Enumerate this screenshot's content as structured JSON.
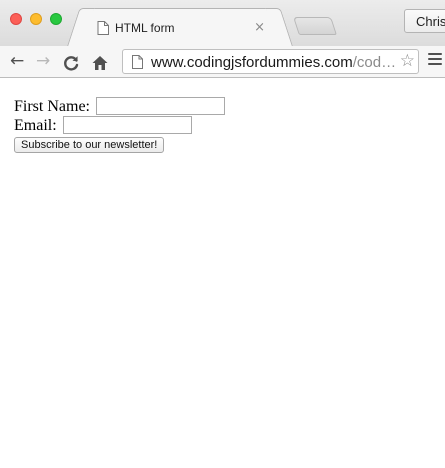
{
  "window": {
    "tab_title": "HTML form",
    "tab_close": "×",
    "profile_name": "Chris"
  },
  "toolbar": {
    "back": "←",
    "forward": "→",
    "url_host": "www.codingjsfordummies.com",
    "url_path": "/cod…",
    "star": "☆"
  },
  "form": {
    "first_name_label": "First Name:",
    "first_name_value": "",
    "email_label": "Email:",
    "email_value": "",
    "submit_label": "Subscribe to our newsletter!"
  },
  "colors": {
    "close": "#fc5f57",
    "minimize": "#fdbc2e",
    "maximize": "#28c840"
  },
  "icons": [
    "page-icon",
    "close-icon",
    "back-arrow-icon",
    "forward-arrow-icon",
    "reload-icon",
    "home-icon",
    "star-icon",
    "hamburger-menu-icon"
  ]
}
